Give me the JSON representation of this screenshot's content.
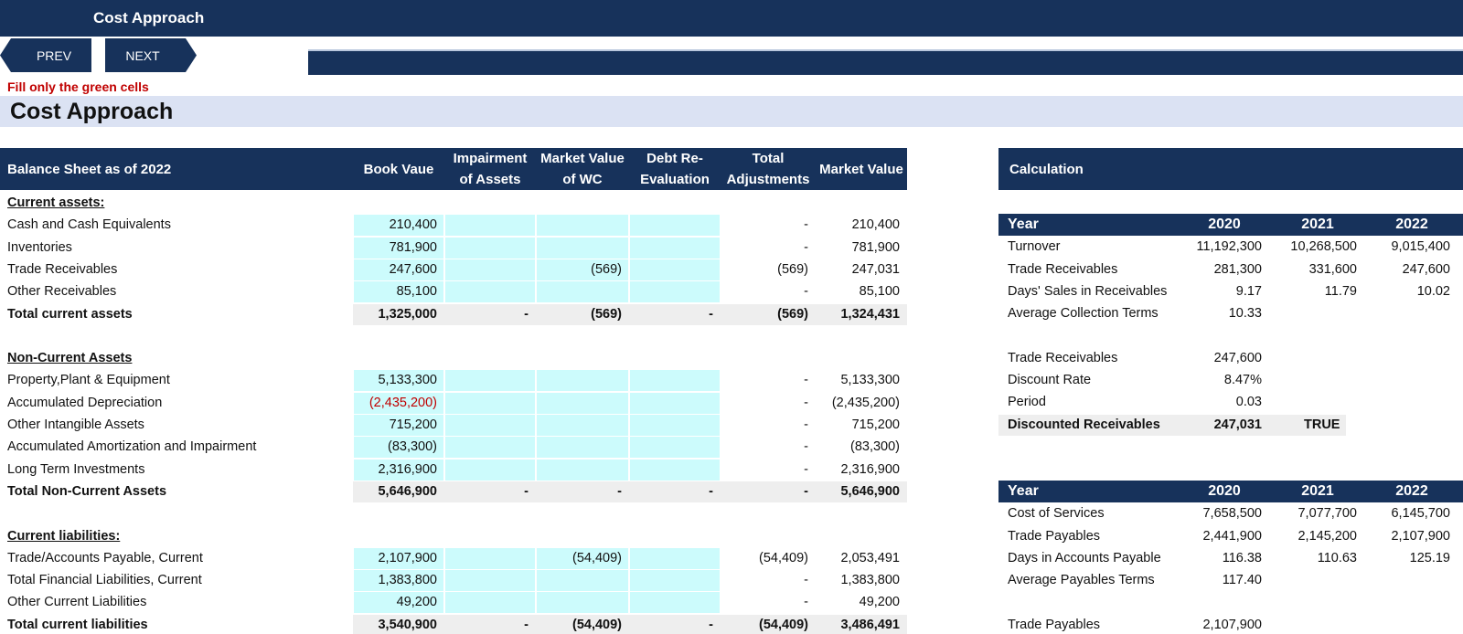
{
  "header": {
    "title": "Cost Approach"
  },
  "nav": {
    "prev": "PREV",
    "next": "NEXT"
  },
  "hint": "Fill only the green cells",
  "section_title": "Cost Approach",
  "balance": {
    "columns": [
      "Balance Sheet as of 2022",
      "Book Vaue",
      "Impairment of Assets",
      "Market Value of WC",
      "Debt Re-Evaluation",
      "Total Adjustments",
      "Market Value"
    ],
    "col_lines": {
      "impairment": [
        "Impairment",
        "of Assets"
      ],
      "mvwc": [
        "Market Value",
        "of WC"
      ],
      "debt": [
        "Debt Re-",
        "Evaluation"
      ],
      "total": [
        "Total",
        "Adjustments"
      ]
    },
    "rows": [
      {
        "label": "Current assets:",
        "type": "heading"
      },
      {
        "label": "Cash and Cash Equivalents",
        "book": "210,400",
        "imp": "",
        "wc": "",
        "debt": "",
        "adj": "-",
        "mv": "210,400"
      },
      {
        "label": "Inventories",
        "book": "781,900",
        "imp": "",
        "wc": "",
        "debt": "",
        "adj": "-",
        "mv": "781,900"
      },
      {
        "label": "Trade Receivables",
        "book": "247,600",
        "imp": "",
        "wc": "(569)",
        "debt": "",
        "adj": "(569)",
        "mv": "247,031"
      },
      {
        "label": "Other Receivables",
        "book": "85,100",
        "imp": "",
        "wc": "",
        "debt": "",
        "adj": "-",
        "mv": "85,100"
      },
      {
        "label": "Total current assets",
        "type": "total",
        "book": "1,325,000",
        "imp": "-",
        "wc": "(569)",
        "debt": "-",
        "adj": "(569)",
        "mv": "1,324,431"
      },
      {
        "label": "",
        "type": "blank"
      },
      {
        "label": "Non-Current Assets",
        "type": "heading"
      },
      {
        "label": "Property,Plant & Equipment",
        "book": "5,133,300",
        "imp": "",
        "wc": "",
        "debt": "",
        "adj": "-",
        "mv": "5,133,300"
      },
      {
        "label": "Accumulated Depreciation",
        "book": "(2,435,200)",
        "book_red": true,
        "imp": "",
        "wc": "",
        "debt": "",
        "adj": "-",
        "mv": "(2,435,200)"
      },
      {
        "label": "Other Intangible Assets",
        "book": "715,200",
        "imp": "",
        "wc": "",
        "debt": "",
        "adj": "-",
        "mv": "715,200"
      },
      {
        "label": "Accumulated Amortization and Impairment",
        "book": "(83,300)",
        "imp": "",
        "wc": "",
        "debt": "",
        "adj": "-",
        "mv": "(83,300)"
      },
      {
        "label": "Long Term Investments",
        "book": "2,316,900",
        "imp": "",
        "wc": "",
        "debt": "",
        "adj": "-",
        "mv": "2,316,900"
      },
      {
        "label": "Total Non-Current Assets",
        "type": "total",
        "book": "5,646,900",
        "imp": "-",
        "wc": "-",
        "debt": "-",
        "adj": "-",
        "mv": "5,646,900"
      },
      {
        "label": "",
        "type": "blank"
      },
      {
        "label": "Current liabilities:",
        "type": "heading"
      },
      {
        "label": "Trade/Accounts Payable, Current",
        "book": "2,107,900",
        "imp": "",
        "wc": "(54,409)",
        "debt": "",
        "adj": "(54,409)",
        "mv": "2,053,491"
      },
      {
        "label": "Total Financial Liabilities, Current",
        "book": "1,383,800",
        "imp": "",
        "wc": "",
        "debt": "",
        "adj": "-",
        "mv": "1,383,800"
      },
      {
        "label": "Other Current Liabilities",
        "book": "49,200",
        "imp": "",
        "wc": "",
        "debt": "",
        "adj": "-",
        "mv": "49,200"
      },
      {
        "label": "Total current liabilities",
        "type": "total",
        "book": "3,540,900",
        "imp": "-",
        "wc": "(54,409)",
        "debt": "-",
        "adj": "(54,409)",
        "mv": "3,486,491"
      }
    ]
  },
  "calc": {
    "title": "Calculation",
    "table1": {
      "headers": [
        "Year",
        "2020",
        "2021",
        "2022"
      ],
      "rows": [
        {
          "label": "Turnover",
          "v": [
            "11,192,300",
            "10,268,500",
            "9,015,400"
          ]
        },
        {
          "label": "Trade Receivables",
          "v": [
            "281,300",
            "331,600",
            "247,600"
          ]
        },
        {
          "label": "Days' Sales in Receivables",
          "v": [
            "9.17",
            "11.79",
            "10.02"
          ]
        },
        {
          "label": "Average Collection Terms",
          "v": [
            "10.33",
            "",
            ""
          ]
        },
        {
          "label": "",
          "v": [
            "",
            "",
            ""
          ]
        },
        {
          "label": "Trade Receivables",
          "v": [
            "247,600",
            "",
            ""
          ]
        },
        {
          "label": "Discount Rate",
          "v": [
            "8.47%",
            "",
            ""
          ]
        },
        {
          "label": "Period",
          "v": [
            "0.03",
            "",
            ""
          ]
        },
        {
          "label": "Discounted Receivables",
          "v": [
            "247,031",
            "TRUE",
            ""
          ],
          "bold": true
        }
      ]
    },
    "table2": {
      "headers": [
        "Year",
        "2020",
        "2021",
        "2022"
      ],
      "rows": [
        {
          "label": "Cost of Services",
          "v": [
            "7,658,500",
            "7,077,700",
            "6,145,700"
          ]
        },
        {
          "label": "Trade Payables",
          "v": [
            "2,441,900",
            "2,145,200",
            "2,107,900"
          ]
        },
        {
          "label": "Days in Accounts Payable",
          "v": [
            "116.38",
            "110.63",
            "125.19"
          ]
        },
        {
          "label": "Average Payables Terms",
          "v": [
            "117.40",
            "",
            ""
          ]
        },
        {
          "label": "",
          "v": [
            "",
            "",
            ""
          ]
        },
        {
          "label": "Trade Payables",
          "v": [
            "2,107,900",
            "",
            ""
          ]
        }
      ]
    }
  }
}
